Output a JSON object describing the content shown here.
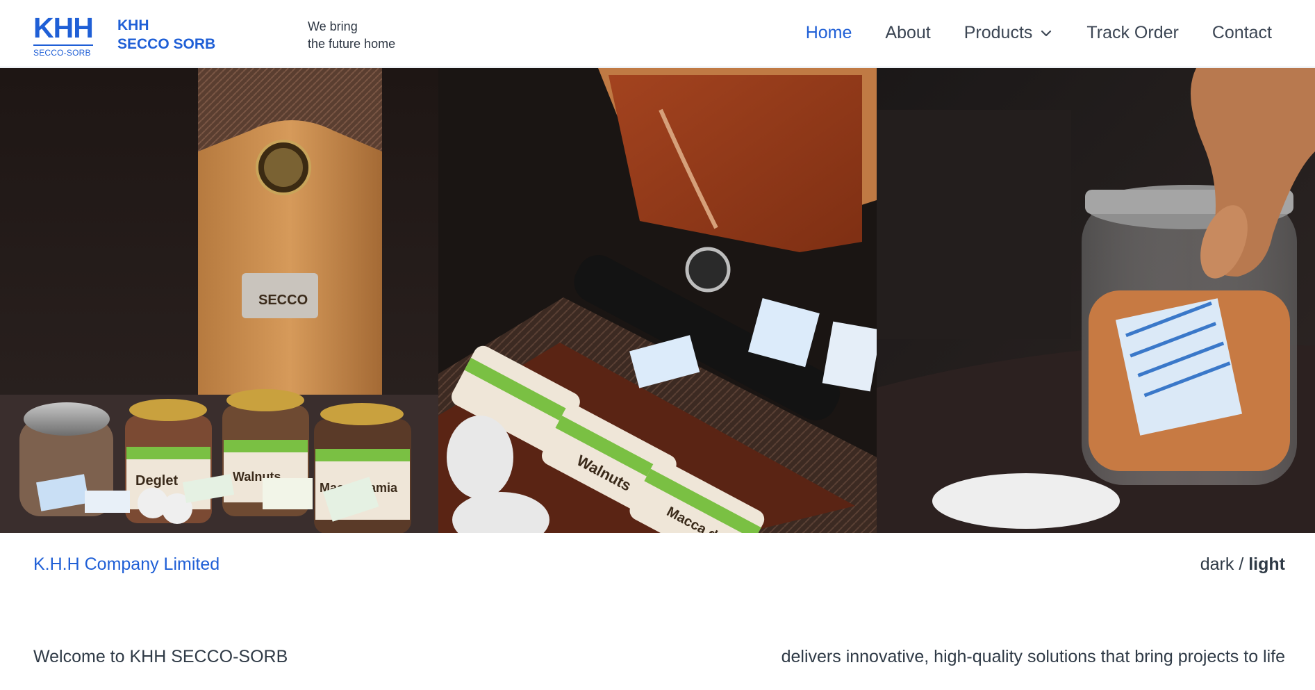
{
  "header": {
    "logo": {
      "mark": "KHH",
      "sub": "SECCO-SORB"
    },
    "brand": {
      "line1": "KHH",
      "line2": "SECCO SORB"
    },
    "tagline": {
      "line1": "We bring",
      "line2": "the future home"
    },
    "nav": {
      "home": "Home",
      "about": "About",
      "products": "Products",
      "track_order": "Track Order",
      "contact": "Contact"
    }
  },
  "hero": {
    "panel1_labels": [
      "SECCO",
      "Deglet",
      "Walnuts",
      "Macca damia"
    ],
    "panel2_labels": [
      "Walnuts",
      "Macca damia"
    ]
  },
  "footer_bar": {
    "company": "K.H.H Company Limited",
    "theme_dark": "dark",
    "theme_sep": " / ",
    "theme_light": "light"
  },
  "intro": {
    "welcome": "Welcome to KHH SECCO-SORB",
    "tagline": "delivers innovative, high-quality solutions that bring projects to life"
  },
  "colors": {
    "accent": "#1f5fd6",
    "text": "#2f3a46",
    "nav_text": "#3c4654"
  }
}
